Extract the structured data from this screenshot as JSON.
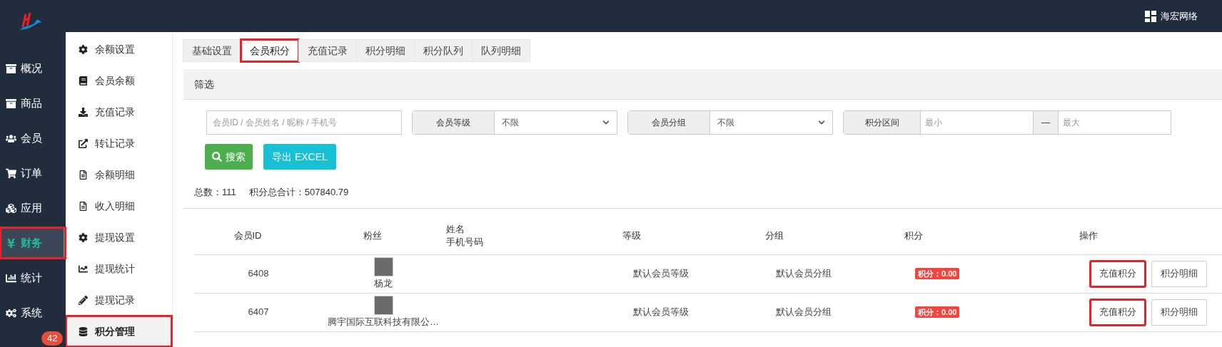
{
  "top_bar": {
    "brand": "海宏网络"
  },
  "nav": {
    "items": [
      {
        "label": "概况",
        "selected": false,
        "highlighted": false
      },
      {
        "label": "商品",
        "selected": false,
        "highlighted": false
      },
      {
        "label": "会员",
        "selected": false,
        "highlighted": false
      },
      {
        "label": "订单",
        "selected": false,
        "highlighted": false
      },
      {
        "label": "应用",
        "selected": false,
        "highlighted": false
      },
      {
        "label": "财务",
        "selected": true,
        "highlighted": true
      },
      {
        "label": "统计",
        "selected": false,
        "highlighted": false
      },
      {
        "label": "系统",
        "selected": false,
        "highlighted": false
      }
    ],
    "badge": "42"
  },
  "subnav": {
    "items": [
      {
        "label": "余额设置",
        "selected": false,
        "highlighted": false
      },
      {
        "label": "会员余额",
        "selected": false,
        "highlighted": false
      },
      {
        "label": "充值记录",
        "selected": false,
        "highlighted": false
      },
      {
        "label": "转让记录",
        "selected": false,
        "highlighted": false
      },
      {
        "label": "余额明细",
        "selected": false,
        "highlighted": false
      },
      {
        "label": "收入明细",
        "selected": false,
        "highlighted": false
      },
      {
        "label": "提现设置",
        "selected": false,
        "highlighted": false
      },
      {
        "label": "提现统计",
        "selected": false,
        "highlighted": false
      },
      {
        "label": "提现记录",
        "selected": false,
        "highlighted": false
      },
      {
        "label": "积分管理",
        "selected": true,
        "highlighted": true
      }
    ]
  },
  "tabs": [
    {
      "label": "基础设置",
      "selected": false,
      "highlighted": false
    },
    {
      "label": "会员积分",
      "selected": true,
      "highlighted": true
    },
    {
      "label": "充值记录",
      "selected": false,
      "highlighted": false
    },
    {
      "label": "积分明细",
      "selected": false,
      "highlighted": false
    },
    {
      "label": "积分队列",
      "selected": false,
      "highlighted": false
    },
    {
      "label": "队列明细",
      "selected": false,
      "highlighted": false
    }
  ],
  "filter": {
    "title": "筛选",
    "search": {
      "placeholder": "会员ID / 会员姓名 / 昵称 / 手机号"
    },
    "level": {
      "label": "会员等级",
      "value": "不限"
    },
    "group": {
      "label": "会员分组",
      "value": "不限"
    },
    "range": {
      "label": "积分区间",
      "min_placeholder": "最小",
      "separator": "—",
      "max_placeholder": "最大"
    },
    "search_button": "搜索",
    "export_button": "导出 EXCEL"
  },
  "summary": {
    "total_label": "总数：",
    "total": "111",
    "sum_label": "积分总合计：",
    "sum": "507840.79"
  },
  "table": {
    "columns": [
      "会员ID",
      "粉丝",
      "姓名",
      "手机号码",
      "等级",
      "分组",
      "积分",
      "操作"
    ],
    "rows": [
      {
        "id": "6408",
        "fan": "杨龙",
        "level": "默认会员等级",
        "group": "默认会员分组",
        "points": "积分：0.00",
        "actions": [
          {
            "label": "充值积分",
            "highlighted": true
          },
          {
            "label": "积分明细",
            "highlighted": false
          }
        ]
      },
      {
        "id": "6407",
        "fan": "腾宇国际互联科技有限公…",
        "level": "默认会员等级",
        "group": "默认会员分组",
        "points": "积分：0.00",
        "actions": [
          {
            "label": "充值积分",
            "highlighted": true
          },
          {
            "label": "积分明细",
            "highlighted": false
          }
        ]
      }
    ]
  }
}
